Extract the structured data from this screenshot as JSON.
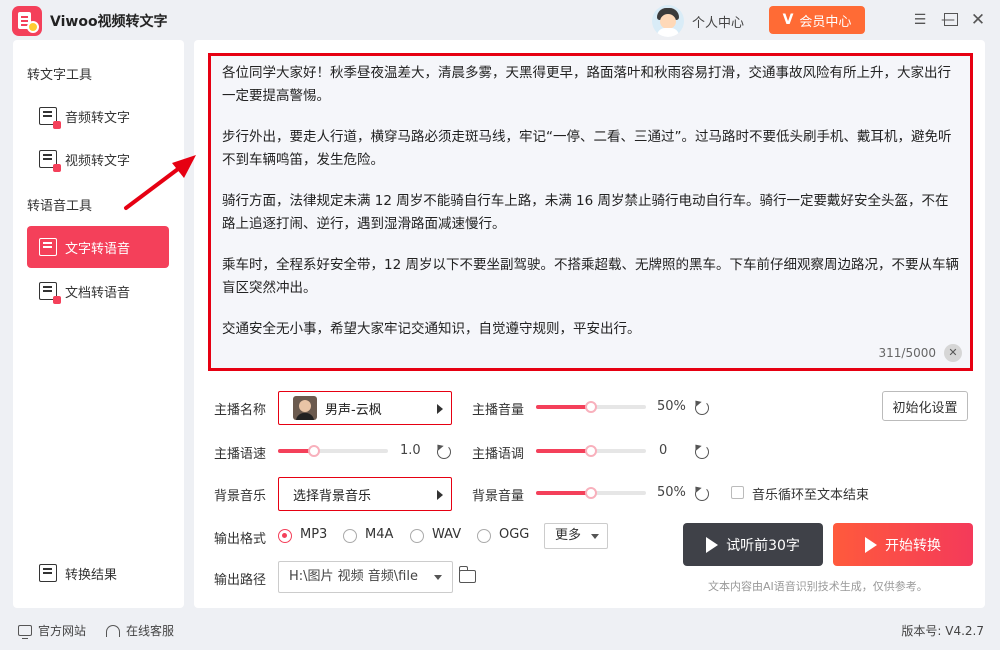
{
  "app": {
    "title": "Viwoo视频转文字",
    "user_center": "个人中心",
    "vip_label": "会员中心",
    "vip_mark": "V",
    "window_controls": {
      "menu": "menu-icon",
      "minimize": "minimize-icon",
      "maximize": "maximize-icon",
      "close": "close-icon"
    }
  },
  "sidebar": {
    "section_text_tools": "转文字工具",
    "section_speech_tools": "转语音工具",
    "items": [
      {
        "label": "音频转文字",
        "icon": "audio-to-text-icon",
        "active": false
      },
      {
        "label": "视频转文字",
        "icon": "video-to-text-icon",
        "active": false
      },
      {
        "label": "文字转语音",
        "icon": "text-to-speech-icon",
        "active": true
      },
      {
        "label": "文档转语音",
        "icon": "document-to-speech-icon",
        "active": false
      }
    ],
    "results_label": "转换结果"
  },
  "editor": {
    "paragraphs": [
      "各位同学大家好！秋季昼夜温差大，清晨多雾，天黑得更早，路面落叶和秋雨容易打滑，交通事故风险有所上升，大家出行一定要提高警惕。",
      "步行外出，要走人行道，横穿马路必须走斑马线，牢记“一停、二看、三通过”。过马路时不要低头刷手机、戴耳机，避免听不到车辆鸣笛，发生危险。",
      "骑行方面，法律规定未满 12 周岁不能骑自行车上路，未满 16 周岁禁止骑行电动自行车。骑行一定要戴好安全头盔，不在路上追逐打闹、逆行，遇到湿滑路面减速慢行。",
      "乘车时，全程系好安全带，12 周岁以下不要坐副驾驶。不搭乘超载、无牌照的黑车。下车前仔细观察周边路况，不要从车辆盲区突然冲出。",
      "交通安全无小事，希望大家牢记交通知识，自觉遵守规则，平安出行。"
    ],
    "char_count": "311/5000"
  },
  "settings": {
    "anchor_label": "主播名称",
    "anchor_value": "男声-云枫",
    "volume_label": "主播音量",
    "volume_value": "50%",
    "volume_level": 0.5,
    "init_button": "初始化设置",
    "speed_label": "主播语速",
    "speed_value": "1.0",
    "speed_level": 0.33,
    "pitch_label": "主播语调",
    "pitch_value": "0",
    "pitch_level": 0.5,
    "bgm_label": "背景音乐",
    "bgm_value": "选择背景音乐",
    "bgm_volume_label": "背景音量",
    "bgm_volume_value": "50%",
    "bgm_volume_level": 0.5,
    "loop_label": "音乐循环至文本结束",
    "loop_checked": false,
    "format_label": "输出格式",
    "formats": [
      "MP3",
      "M4A",
      "WAV",
      "OGG"
    ],
    "selected_format": "MP3",
    "more_label": "更多",
    "path_label": "输出路径",
    "path_value": "H:\\图片 视频 音频\\file"
  },
  "actions": {
    "preview": "试听前30字",
    "start": "开始转换",
    "disclaimer": "文本内容由AI语音识别技术生成，仅供参考。"
  },
  "statusbar": {
    "website": "官方网站",
    "support": "在线客服",
    "version": "版本号: V4.2.7"
  },
  "colors": {
    "accent": "#f4405a",
    "vip": "#ff6b35",
    "highlight_border": "#e60012",
    "preview_btn": "#3f4148"
  }
}
